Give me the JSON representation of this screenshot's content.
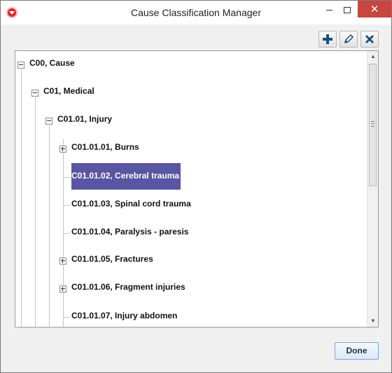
{
  "window": {
    "title": "Cause Classification Manager",
    "close_glyph": "✕"
  },
  "toolbar": {
    "add_icon": "add-icon",
    "edit_icon": "pencil-icon",
    "delete_icon": "delete-icon"
  },
  "tree": {
    "nodes": [
      {
        "label": "C00, Cause",
        "level": 0,
        "expander": "expanded",
        "selected": false
      },
      {
        "label": "C01, Medical",
        "level": 1,
        "expander": "expanded",
        "selected": false
      },
      {
        "label": "C01.01, Injury",
        "level": 2,
        "expander": "expanded",
        "selected": false
      },
      {
        "label": "C01.01.01, Burns",
        "level": 3,
        "expander": "collapsed",
        "selected": false
      },
      {
        "label": "C01.01.02, Cerebral trauma",
        "level": 3,
        "expander": "none",
        "selected": true
      },
      {
        "label": "C01.01.03, Spinal cord trauma",
        "level": 3,
        "expander": "none",
        "selected": false
      },
      {
        "label": "C01.01.04, Paralysis - paresis",
        "level": 3,
        "expander": "none",
        "selected": false
      },
      {
        "label": "C01.01.05, Fractures",
        "level": 3,
        "expander": "collapsed",
        "selected": false
      },
      {
        "label": "C01.01.06, Fragment injuries",
        "level": 3,
        "expander": "collapsed",
        "selected": false
      },
      {
        "label": "C01.01.07, Injury abdomen",
        "level": 3,
        "expander": "none",
        "selected": false
      }
    ]
  },
  "buttons": {
    "done_label": "Done"
  },
  "colors": {
    "selection": "#5a55a3",
    "close_button": "#c7463f",
    "tree_lines": "#b8c7d8"
  }
}
